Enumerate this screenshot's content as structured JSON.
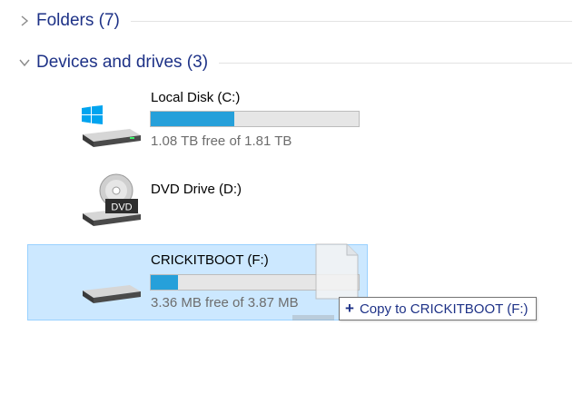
{
  "groups": {
    "folders": {
      "label": "Folders (7)",
      "state": "collapsed"
    },
    "devices": {
      "label": "Devices and drives (3)",
      "state": "expanded"
    }
  },
  "drives": [
    {
      "name": "Local Disk (C:)",
      "free_text": "1.08 TB free of 1.81 TB",
      "used_fraction": 0.403,
      "icon": "windows-drive-icon"
    },
    {
      "name": "DVD Drive (D:)",
      "icon": "dvd-drive-icon",
      "icon_text": "DVD"
    },
    {
      "name": "CRICKITBOOT (F:)",
      "free_text": "3.36 MB free of 3.87 MB",
      "used_fraction": 0.132,
      "icon": "removable-drive-icon",
      "selected": true
    }
  ],
  "drag": {
    "tooltip_action": "+",
    "tooltip_text": "Copy to CRICKITBOOT (F:)"
  },
  "colors": {
    "header_text": "#1e3287",
    "bar_fill": "#26a0da",
    "selection_bg": "#cce8ff",
    "selection_border": "#99d1ff"
  }
}
